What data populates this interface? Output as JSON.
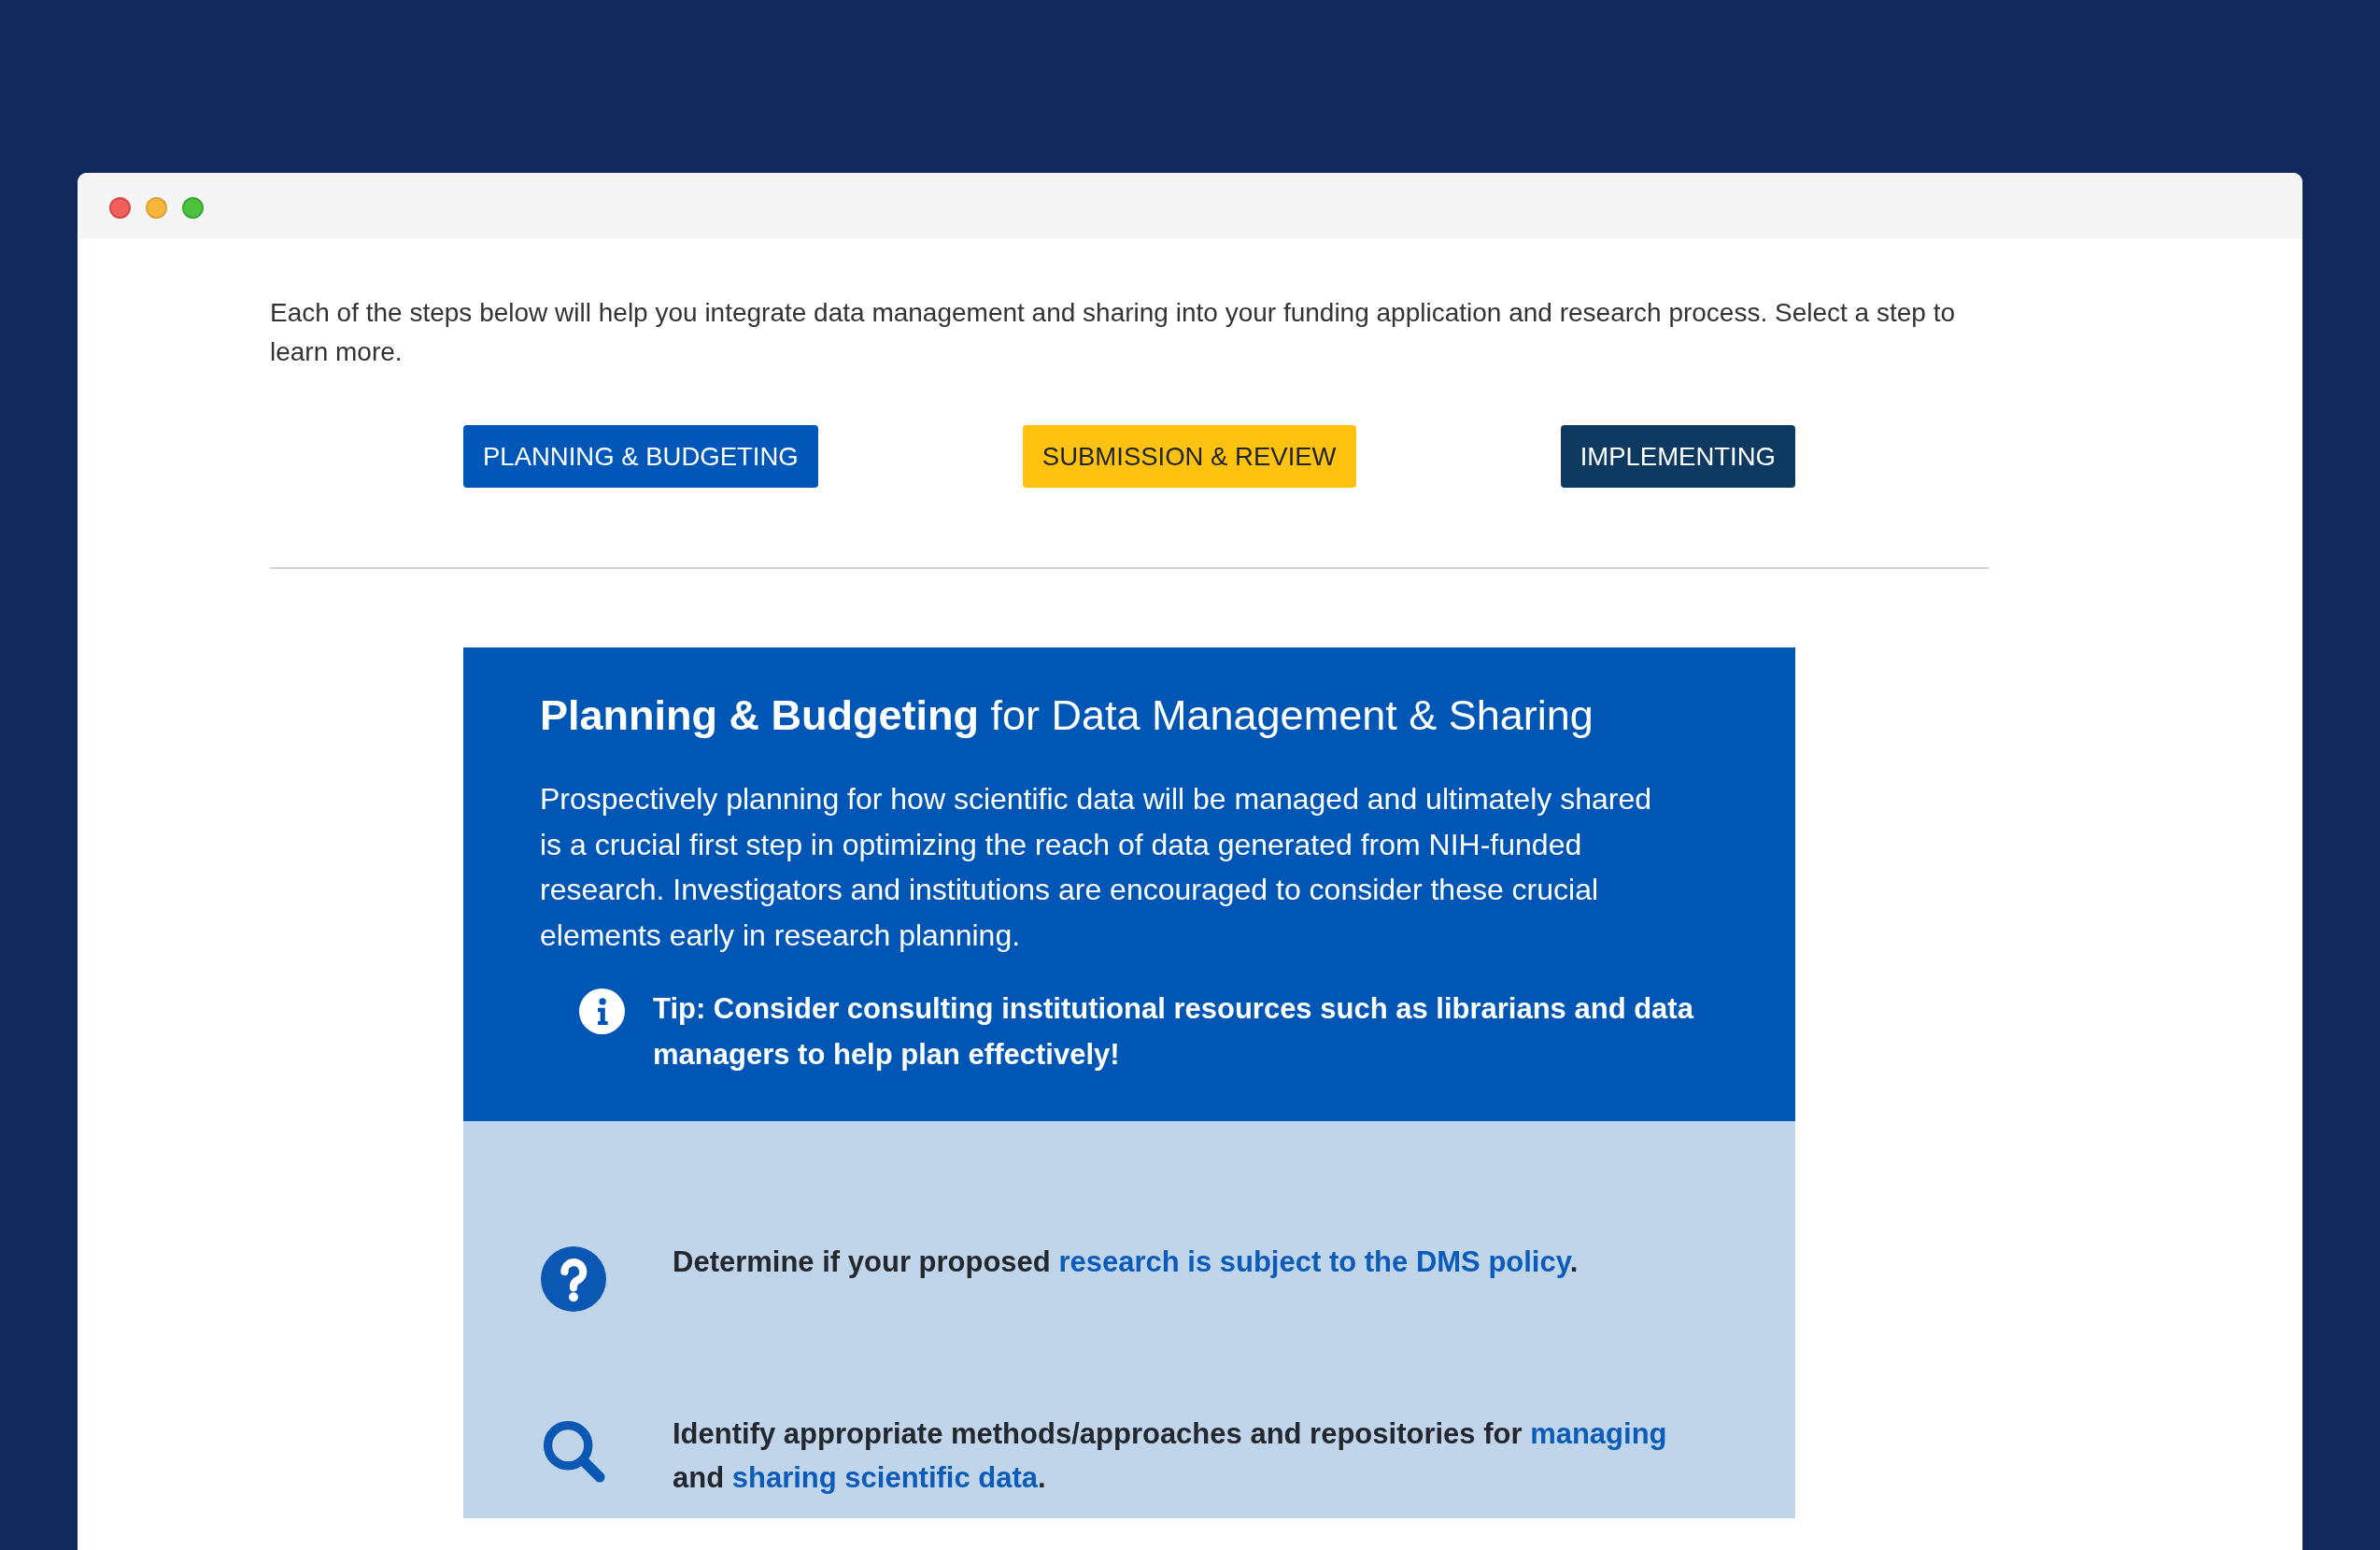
{
  "intro": {
    "text": "Each of the steps below will help you integrate data management and sharing into your funding application and research process. Select a step to learn more."
  },
  "steps": [
    {
      "label": "PLANNING & BUDGETING",
      "color": "#0057b8"
    },
    {
      "label": "SUBMISSION & REVIEW",
      "color": "#ffc20e"
    },
    {
      "label": "IMPLEMENTING",
      "color": "#0e3a62"
    }
  ],
  "panel": {
    "title": "**Planning & Budgeting** for Data Management & Sharing",
    "description": "Prospectively planning for how scientific data will be managed and ultimately shared is a crucial first step in optimizing the reach of data generated from NIH-funded research. Investigators and institutions are encouraged to consider these crucial elements early in research planning.",
    "tip": "Tip: Consider consulting institutional resources such as librarians and data managers to help plan effectively!"
  },
  "actions": [
    {
      "kind": "question",
      "segments": [
        {
          "kind": "text",
          "text": "Determine if your proposed "
        },
        {
          "kind": "link",
          "text": "research is subject to the DMS policy"
        },
        {
          "kind": "text",
          "text": "."
        }
      ]
    },
    {
      "kind": "search",
      "segments": [
        {
          "kind": "text",
          "text": "Identify appropriate methods/approaches and repositories for "
        },
        {
          "kind": "link",
          "text": "managing"
        },
        {
          "kind": "text",
          "text": " and "
        },
        {
          "kind": "link",
          "text": "sharing scientific data"
        },
        {
          "kind": "text",
          "text": "."
        }
      ]
    }
  ]
}
